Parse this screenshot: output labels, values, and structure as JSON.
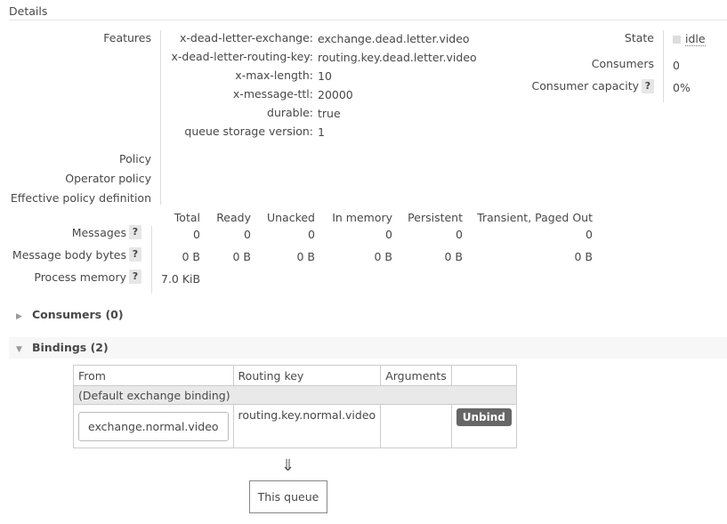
{
  "details_title": "Details",
  "features": {
    "label": "Features",
    "items": [
      {
        "key": "x-dead-letter-exchange:",
        "value": "exchange.dead.letter.video"
      },
      {
        "key": "x-dead-letter-routing-key:",
        "value": "routing.key.dead.letter.video"
      },
      {
        "key": "x-max-length:",
        "value": "10"
      },
      {
        "key": "x-message-ttl:",
        "value": "20000"
      },
      {
        "key": "durable:",
        "value": "true"
      },
      {
        "key": "queue storage version:",
        "value": "1"
      }
    ]
  },
  "policy_label": "Policy",
  "operator_policy_label": "Operator policy",
  "effective_policy_label": "Effective policy definition",
  "state": {
    "label": "State",
    "value": "idle"
  },
  "consumers": {
    "label": "Consumers",
    "value": "0"
  },
  "consumer_capacity": {
    "label": "Consumer capacity",
    "value": "0%"
  },
  "help_glyph": "?",
  "stats": {
    "headers": [
      "Total",
      "Ready",
      "Unacked",
      "In memory",
      "Persistent",
      "Transient, Paged Out"
    ],
    "messages": {
      "label": "Messages",
      "values": [
        "0",
        "0",
        "0",
        "0",
        "0",
        "0"
      ]
    },
    "body_bytes": {
      "label": "Message body bytes",
      "values": [
        "0 B",
        "0 B",
        "0 B",
        "0 B",
        "0 B",
        "0 B"
      ]
    },
    "process_memory": {
      "label": "Process memory",
      "value": "7.0 KiB"
    }
  },
  "consumers_section": {
    "label": "Consumers (0)"
  },
  "bindings_section": {
    "label": "Bindings (2)"
  },
  "bindings_table": {
    "headers": [
      "From",
      "Routing key",
      "Arguments"
    ],
    "default_binding": "(Default exchange binding)",
    "row": {
      "from": "exchange.normal.video",
      "routing_key": "routing.key.normal.video",
      "arguments": "",
      "unbind_label": "Unbind"
    }
  },
  "arrow_glyph": "⇓",
  "this_queue_label": "This queue"
}
